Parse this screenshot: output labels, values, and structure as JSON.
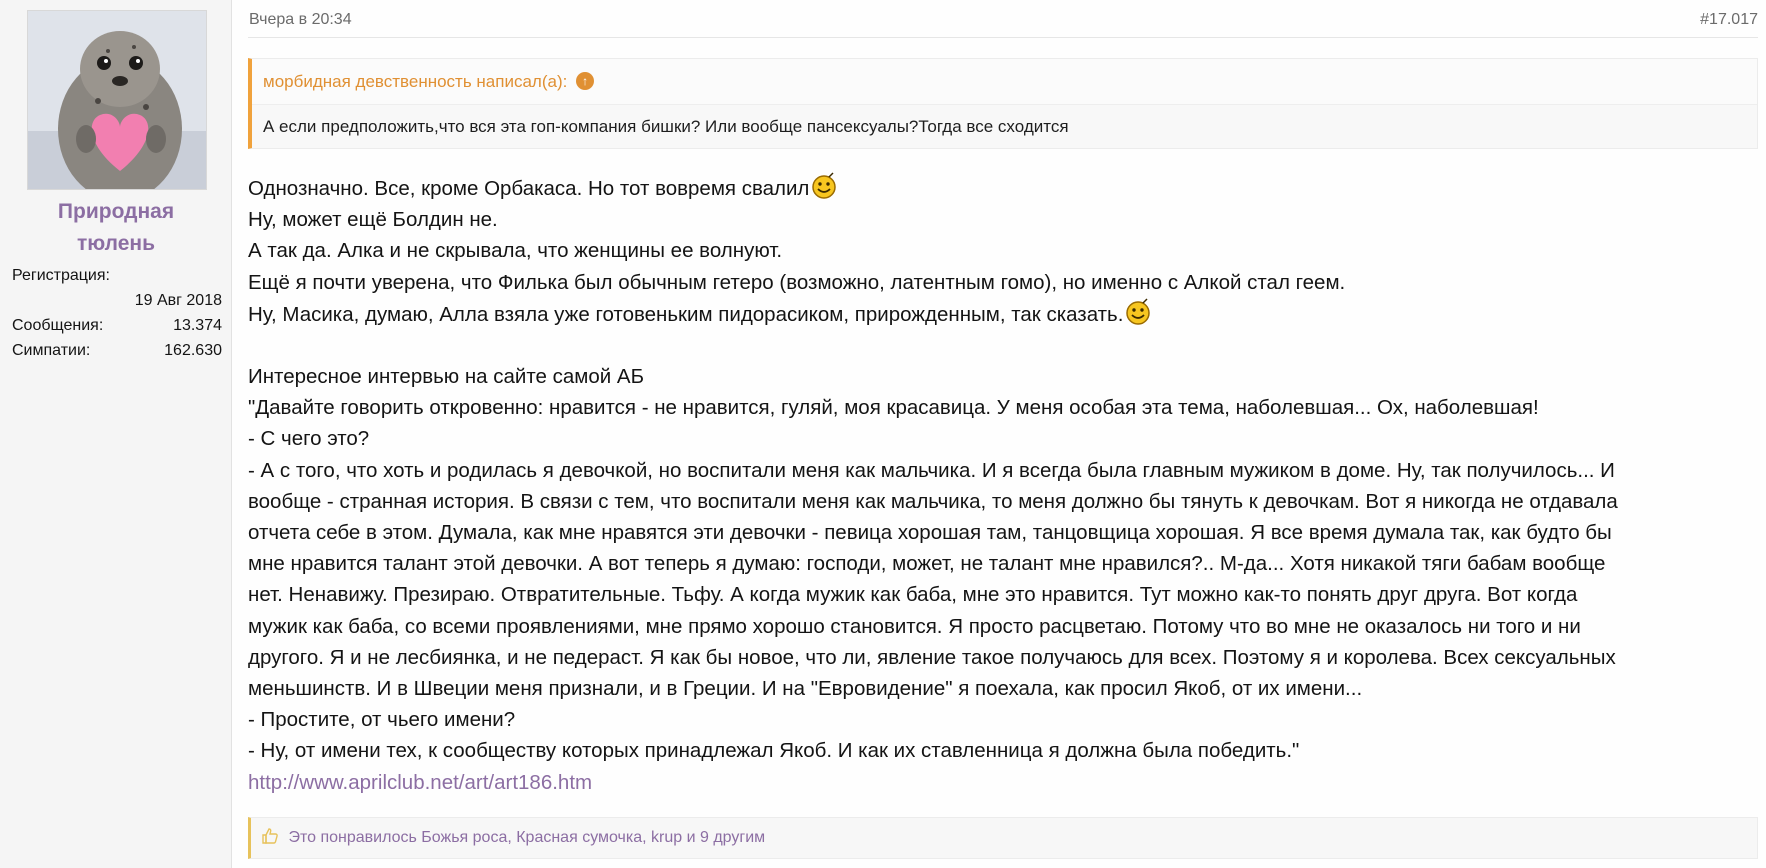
{
  "user": {
    "name_line1": "Природная",
    "name_line2": "тюлень",
    "registration_label": "Регистрация:",
    "registration_value": "19 Авг 2018",
    "messages_label": "Сообщения:",
    "messages_value": "13.374",
    "likes_label": "Симпатии:",
    "likes_value": "162.630"
  },
  "post": {
    "date": "Вчера в 20:34",
    "number": "#17.017"
  },
  "quote": {
    "author": "морбидная девственность написал(а):",
    "text": "А если предположить,что вся эта гоп-компания бишки? Или вообще пансексуалы?Тогда все сходится"
  },
  "message": {
    "line1": "Однозначно. Все, кроме Орбакаса. Но тот вовремя свалил",
    "line2": "Ну, может ещё Болдин не.",
    "line3": "А так да. Алка и не скрывала, что женщины ее волнуют.",
    "line4": "Ещё я почти уверена, что Филька был обычным гетеро (возможно, латентным гомо), но именно с Алкой стал геем.",
    "line5": "Ну, Масика, думаю, Алла взяла уже готовеньким пидорасиком, прирожденным, так сказать.",
    "line6": "Интересное интервью на сайте самой АБ",
    "line7": "\"Давайте говорить откровенно: нравится - не нравится, гуляй, моя красавица. У меня особая эта тема, наболевшая... Ох, наболевшая!",
    "line8": "- С чего это?",
    "line9": "- А с того, что хоть и родилась я девочкой, но воспитали меня как мальчика. И я всегда была главным мужиком в доме. Ну, так получилось... И",
    "line10": "вообще - странная история. В связи с тем, что воспитали меня как мальчика, то меня должно бы тянуть к девочкам. Вот я никогда не отдавала",
    "line11": "отчета себе в этом. Думала, как мне нравятся эти девочки - певица хорошая там, танцовщица хорошая. Я все время думала так, как будто бы",
    "line12": "мне нравится талант этой девочки. А вот теперь я думаю: господи, может, не талант мне нравился?.. М-да... Хотя никакой тяги бабам вообще",
    "line13": "нет. Ненавижу. Презираю. Отвратительные. Тьфу. А когда мужик как баба, мне это нравится. Тут можно как-то понять друг друга. Вот когда",
    "line14": "мужик как баба, со всеми проявлениями, мне прямо хорошо становится. Я просто расцветаю. Потому что во мне не оказалось ни того и ни",
    "line15": "другого. Я и не лесбиянка, и не педераст. Я как бы новое, что ли, явление такое получаюсь для всех. Поэтому я и королева. Всех сексуальных",
    "line16": "меньшинств. И в Швеции меня признали, и в Греции. И на \"Евровидение\" я поехала, как просил Якоб, от их имени...",
    "line17": "- Простите, от чьего имени?",
    "line18": "- Ну, от имени тех, к сообществу которых принадлежал Якоб. И как их ставленница я должна была победить.\"",
    "link": "http://www.aprilclub.net/art/art186.htm"
  },
  "likes": {
    "text": "Это понравилось Божья роса, Красная сумочка, krup и 9 другим"
  },
  "colors": {
    "accent_purple": "#8c6ea3",
    "quote_orange": "#e09033",
    "like_gold": "#e7c25b"
  },
  "icons": {
    "quote_jump": "up-arrow-circle-icon",
    "smiley": "smiley-icon",
    "like": "thumbs-up-icon"
  }
}
